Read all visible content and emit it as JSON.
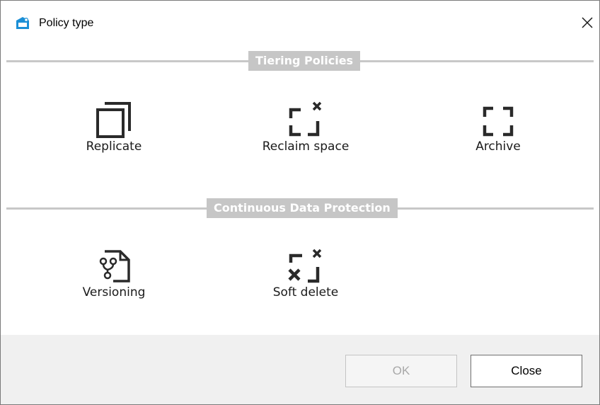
{
  "window": {
    "title": "Policy type"
  },
  "sections": {
    "tiering": {
      "label": "Tiering Policies",
      "items": [
        {
          "label": "Replicate",
          "icon": "replicate-icon"
        },
        {
          "label": "Reclaim space",
          "icon": "reclaim-space-icon"
        },
        {
          "label": "Archive",
          "icon": "archive-icon"
        }
      ]
    },
    "cdp": {
      "label": "Continuous Data Protection",
      "items": [
        {
          "label": "Versioning",
          "icon": "versioning-icon"
        },
        {
          "label": "Soft delete",
          "icon": "soft-delete-icon"
        }
      ]
    }
  },
  "footer": {
    "ok_label": "OK",
    "close_label": "Close"
  },
  "colors": {
    "divider": "#c8c8c8",
    "section_label_bg": "#c6c6c6",
    "icon": "#2a2a2a",
    "app_icon": "#1b8fd6",
    "footer_bg": "#f0f0f0"
  }
}
